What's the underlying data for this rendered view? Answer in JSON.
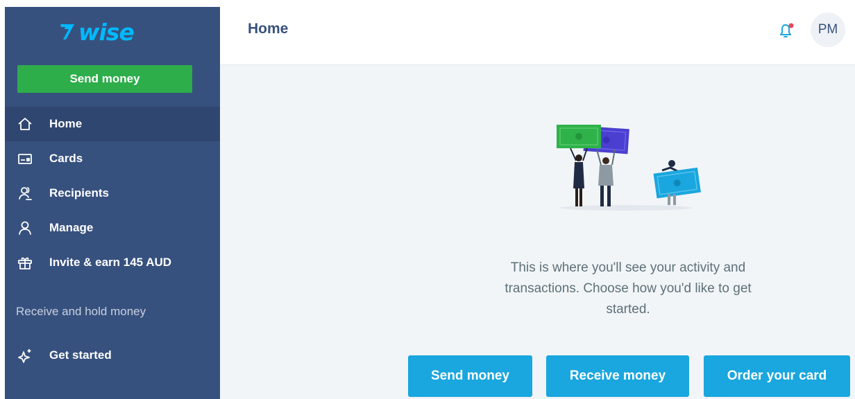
{
  "brand": {
    "logo_text": "wise",
    "logo_color": "#00b9ff"
  },
  "colors": {
    "sidebar_bg": "#37517e",
    "sidebar_active_bg": "#2f4670",
    "primary_green": "#2ead4b",
    "action_blue": "#1aa6de",
    "content_bg": "#f2f5f7",
    "notification_dot": "#e8475a"
  },
  "sidebar": {
    "send_money_label": "Send money",
    "items": [
      {
        "label": "Home",
        "icon": "home-icon",
        "active": true
      },
      {
        "label": "Cards",
        "icon": "card-icon",
        "active": false
      },
      {
        "label": "Recipients",
        "icon": "recipients-icon",
        "active": false
      },
      {
        "label": "Manage",
        "icon": "user-icon",
        "active": false
      },
      {
        "label": "Invite & earn 145 AUD",
        "icon": "gift-icon",
        "active": false
      }
    ],
    "section_label": "Receive and hold money",
    "get_started": {
      "label": "Get started",
      "icon": "sparkle-icon"
    }
  },
  "header": {
    "title": "Home",
    "bell_icon": "bell-icon",
    "avatar_initials": "PM"
  },
  "main": {
    "empty_state_text": "This is where you'll see your activity and transactions. Choose how you'd like to get started.",
    "actions": [
      "Send money",
      "Receive money",
      "Order your card"
    ]
  }
}
